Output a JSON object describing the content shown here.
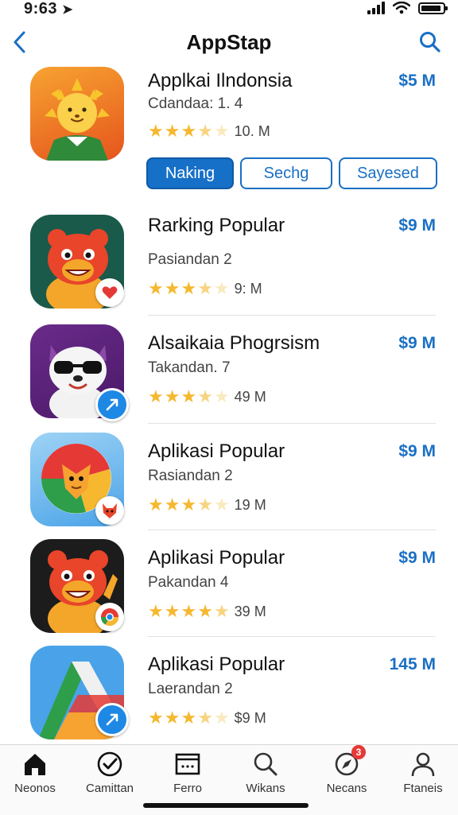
{
  "status": {
    "time": "9:63",
    "arrow": "➤"
  },
  "nav": {
    "title": "AppStap"
  },
  "colors": {
    "accent": "#1a6fc4",
    "star": "#f5b82e",
    "badge_red": "#e53935"
  },
  "filters": [
    {
      "label": "Naking",
      "active": true
    },
    {
      "label": "Sechg",
      "active": false
    },
    {
      "label": "Sayesed",
      "active": false
    }
  ],
  "apps": [
    {
      "name": "Applkai Ilndonsia",
      "price": "$5 M",
      "sub": "Cdandaa: 1. 4",
      "rating": 3.5,
      "count": "10. M",
      "icon": "sun-lion-icon"
    },
    {
      "name": "Rarking Popular",
      "price": "$9 M",
      "sub": "Pasiandan 2",
      "rating": 3.5,
      "count": "9: M",
      "icon": "red-bear-icon",
      "badge": "heart-icon"
    },
    {
      "name": "Alsaikaia Phogrsism",
      "price": "$9 M",
      "sub": "Takandan. 7",
      "rating": 3.5,
      "count": "49 M",
      "icon": "raccoon-glasses-icon",
      "badge": "arrow-badge-icon"
    },
    {
      "name": "Aplikasi Popular",
      "price": "$9 M",
      "sub": "Rasiandan 2",
      "rating": 3.5,
      "count": "19 M",
      "icon": "chrome-fox-icon",
      "badge": "fox-badge-icon"
    },
    {
      "name": "Aplikasi Popular",
      "price": "$9 M",
      "sub": "Pakandan 4",
      "rating": 4.5,
      "count": "39 M",
      "icon": "waving-bear-icon",
      "badge": "chrome-badge-icon"
    },
    {
      "name": "Aplikasi Popular",
      "price": "145 M",
      "sub": "Laerandan 2",
      "rating": 3.5,
      "count": "$9 M",
      "icon": "drive-triangle-icon",
      "badge": "arrow-badge-icon"
    }
  ],
  "tabs": [
    {
      "label": "Neonos",
      "icon": "home-icon"
    },
    {
      "label": "Camittan",
      "icon": "check-badge-icon"
    },
    {
      "label": "Ferro",
      "icon": "window-icon"
    },
    {
      "label": "Wikans",
      "icon": "search-icon"
    },
    {
      "label": "Necans",
      "icon": "compass-icon",
      "notification": "3"
    },
    {
      "label": "Ftaneis",
      "icon": "person-icon"
    }
  ]
}
